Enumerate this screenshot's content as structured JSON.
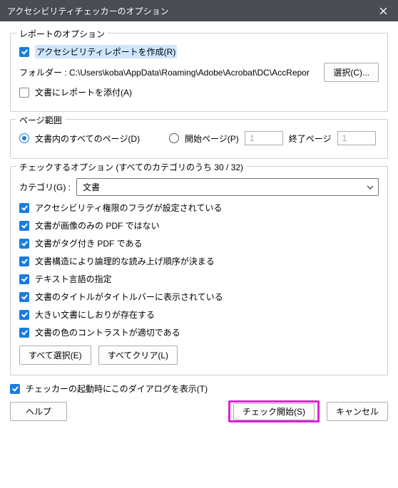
{
  "title": "アクセシビリティチェッカーのオプション",
  "report_options": {
    "legend": "レポートのオプション",
    "create_label": "アクセシビリティレポートを作成(R)",
    "folder_prefix": "フォルダー :",
    "folder_path": "C:\\Users\\koba\\AppData\\Roaming\\Adobe\\Acrobat\\DC\\AccRepor",
    "browse": "選択(C)...",
    "attach_label": "文書にレポートを添付(A)"
  },
  "page_range": {
    "legend": "ページ範囲",
    "all_label": "文書内のすべてのページ(D)",
    "from_label": "開始ページ(P)",
    "from_value": "1",
    "to_label": "終了ページ",
    "to_value": "1"
  },
  "check_options": {
    "legend": "チェックするオプション (すべてのカテゴリのうち 30 / 32)",
    "category_label": "カテゴリ(G) :",
    "category_value": "文書",
    "items": [
      "アクセシビリティ権限のフラグが設定されている",
      "文書が画像のみの PDF ではない",
      "文書がタグ付き PDF である",
      "文書構造により論理的な読み上げ順序が決まる",
      "テキスト言語の指定",
      "文書のタイトルがタイトルバーに表示されている",
      "大きい文書にしおりが存在する",
      "文書の色のコントラストが適切である"
    ],
    "select_all": "すべて選択(E)",
    "clear_all": "すべてクリア(L)"
  },
  "show_on_start": "チェッカーの起動時にこのダイアログを表示(T)",
  "help": "ヘルプ",
  "start": "チェック開始(S)",
  "cancel": "キャンセル"
}
